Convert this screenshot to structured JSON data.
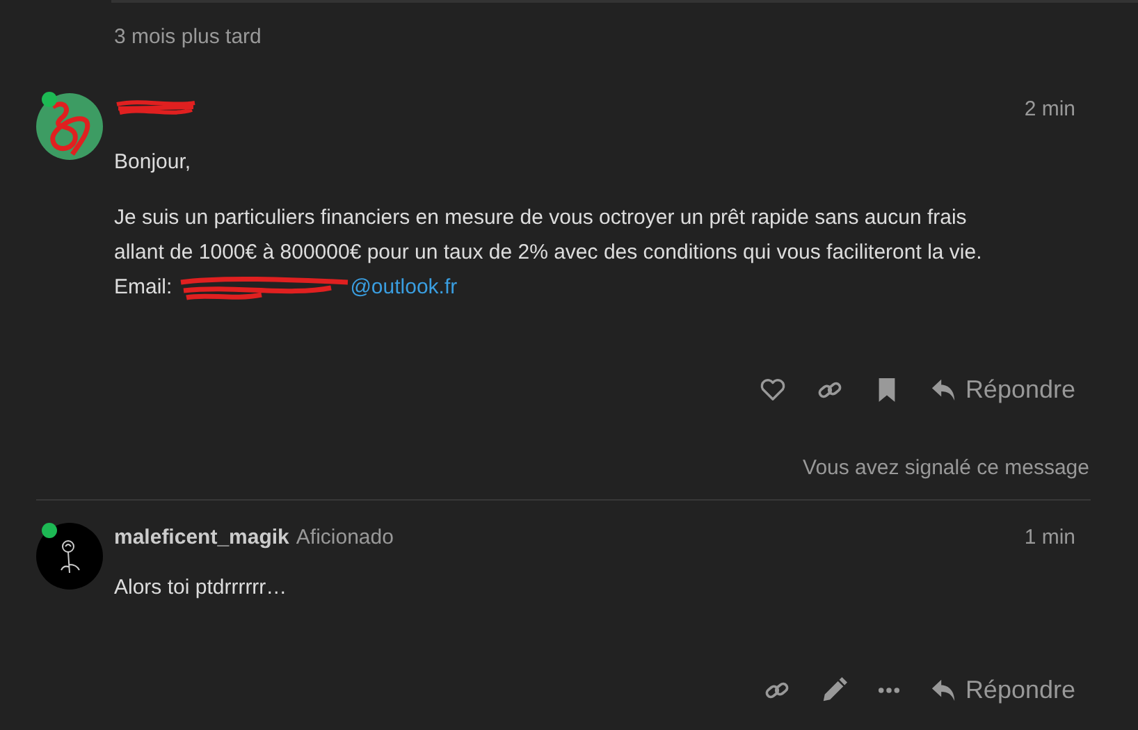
{
  "gap_notice": "3 mois plus tard",
  "posts": [
    {
      "online": true,
      "author_redacted": true,
      "time": "2 min",
      "body": [
        {
          "kind": "text",
          "lines": [
            "Bonjour,"
          ]
        },
        {
          "kind": "text",
          "lines": [
            "Je suis un particuliers financiers en mesure de vous octroyer un prêt rapide sans aucun frais",
            "allant de 1000€ à 800000€ pour un taux de 2% avec des conditions qui vous faciliteront la vie."
          ],
          "email_label": "Email:",
          "email_redacted": true,
          "email_link": "@outlook.fr"
        }
      ],
      "actions": [
        {
          "kind": "like"
        },
        {
          "kind": "link"
        },
        {
          "kind": "bookmark"
        },
        {
          "kind": "reply",
          "label": "Répondre"
        }
      ],
      "flag_notice": "Vous avez signalé ce message"
    },
    {
      "online": true,
      "author": "maleficent_magik",
      "author_redacted": false,
      "user_title": "Aficionado",
      "time": "1 min",
      "body": [
        {
          "kind": "text",
          "lines": [
            "Alors toi ptdrrrrrr…"
          ]
        }
      ],
      "actions": [
        {
          "kind": "link"
        },
        {
          "kind": "edit"
        },
        {
          "kind": "more"
        },
        {
          "kind": "reply",
          "label": "Répondre"
        }
      ]
    }
  ]
}
